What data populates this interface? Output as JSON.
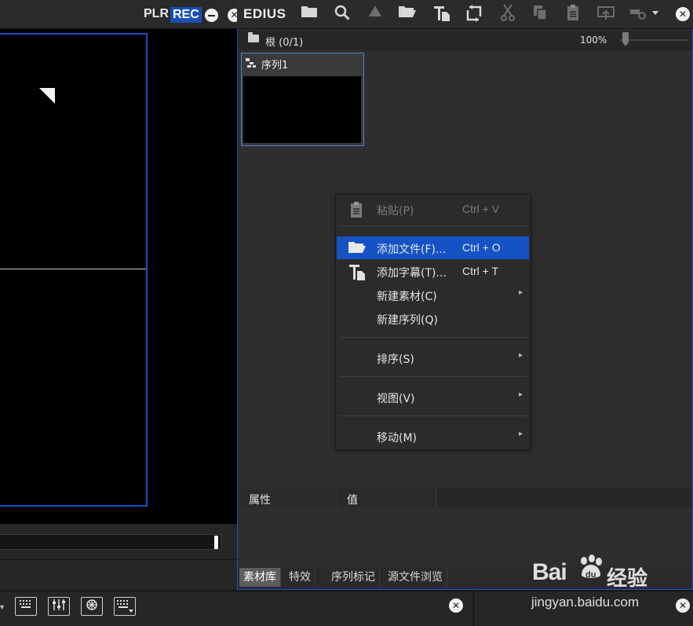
{
  "player": {
    "plr_label": "PLR",
    "rec_label": "REC",
    "close_glyph": "✕",
    "frame_color": "#1d4fc2"
  },
  "bin": {
    "app_label": "EDIUS",
    "close_glyph": "✕",
    "toolbar_icons": [
      "folder-icon",
      "search-icon",
      "up-arrow-icon",
      "open-folder-icon",
      "title-icon",
      "replace-icon",
      "cut-icon",
      "copy-icon",
      "paste-icon",
      "export-icon",
      "add-dropdown-icon"
    ],
    "path": "根 (0/1)",
    "zoom": "100%",
    "clip": {
      "label": "序列1"
    }
  },
  "context_menu": {
    "items": [
      {
        "label": "粘贴(P)",
        "shortcut": "Ctrl + V",
        "icon": "paste-icon",
        "disabled": true
      },
      {
        "label": "添加文件(F)...",
        "shortcut": "Ctrl + O",
        "icon": "open-folder-icon",
        "active": true
      },
      {
        "label": "添加字幕(T)...",
        "shortcut": "Ctrl + T",
        "icon": "title-icon"
      },
      {
        "label": "新建素材(C)",
        "submenu": true
      },
      {
        "label": "新建序列(Q)"
      },
      {
        "label": "排序(S)",
        "submenu": true
      },
      {
        "label": "视图(V)",
        "submenu": true
      },
      {
        "label": "移动(M)",
        "submenu": true
      }
    ],
    "submenu_glyph": "▸",
    "accent": "#1553c5"
  },
  "properties": {
    "attr_header": "属性",
    "value_header": "值"
  },
  "tabs": [
    "素材库",
    "特效",
    "序列标记",
    "源文件浏览"
  ],
  "bottom": {
    "close_glyph": "✕",
    "icons": [
      "keyboard-icon",
      "mixer-icon",
      "burst-icon",
      "keyboard-dropdown-icon"
    ]
  },
  "watermark": {
    "logo": "Bai",
    "paw": "du",
    "brand": "经验",
    "url": "jingyan.baidu.com"
  }
}
